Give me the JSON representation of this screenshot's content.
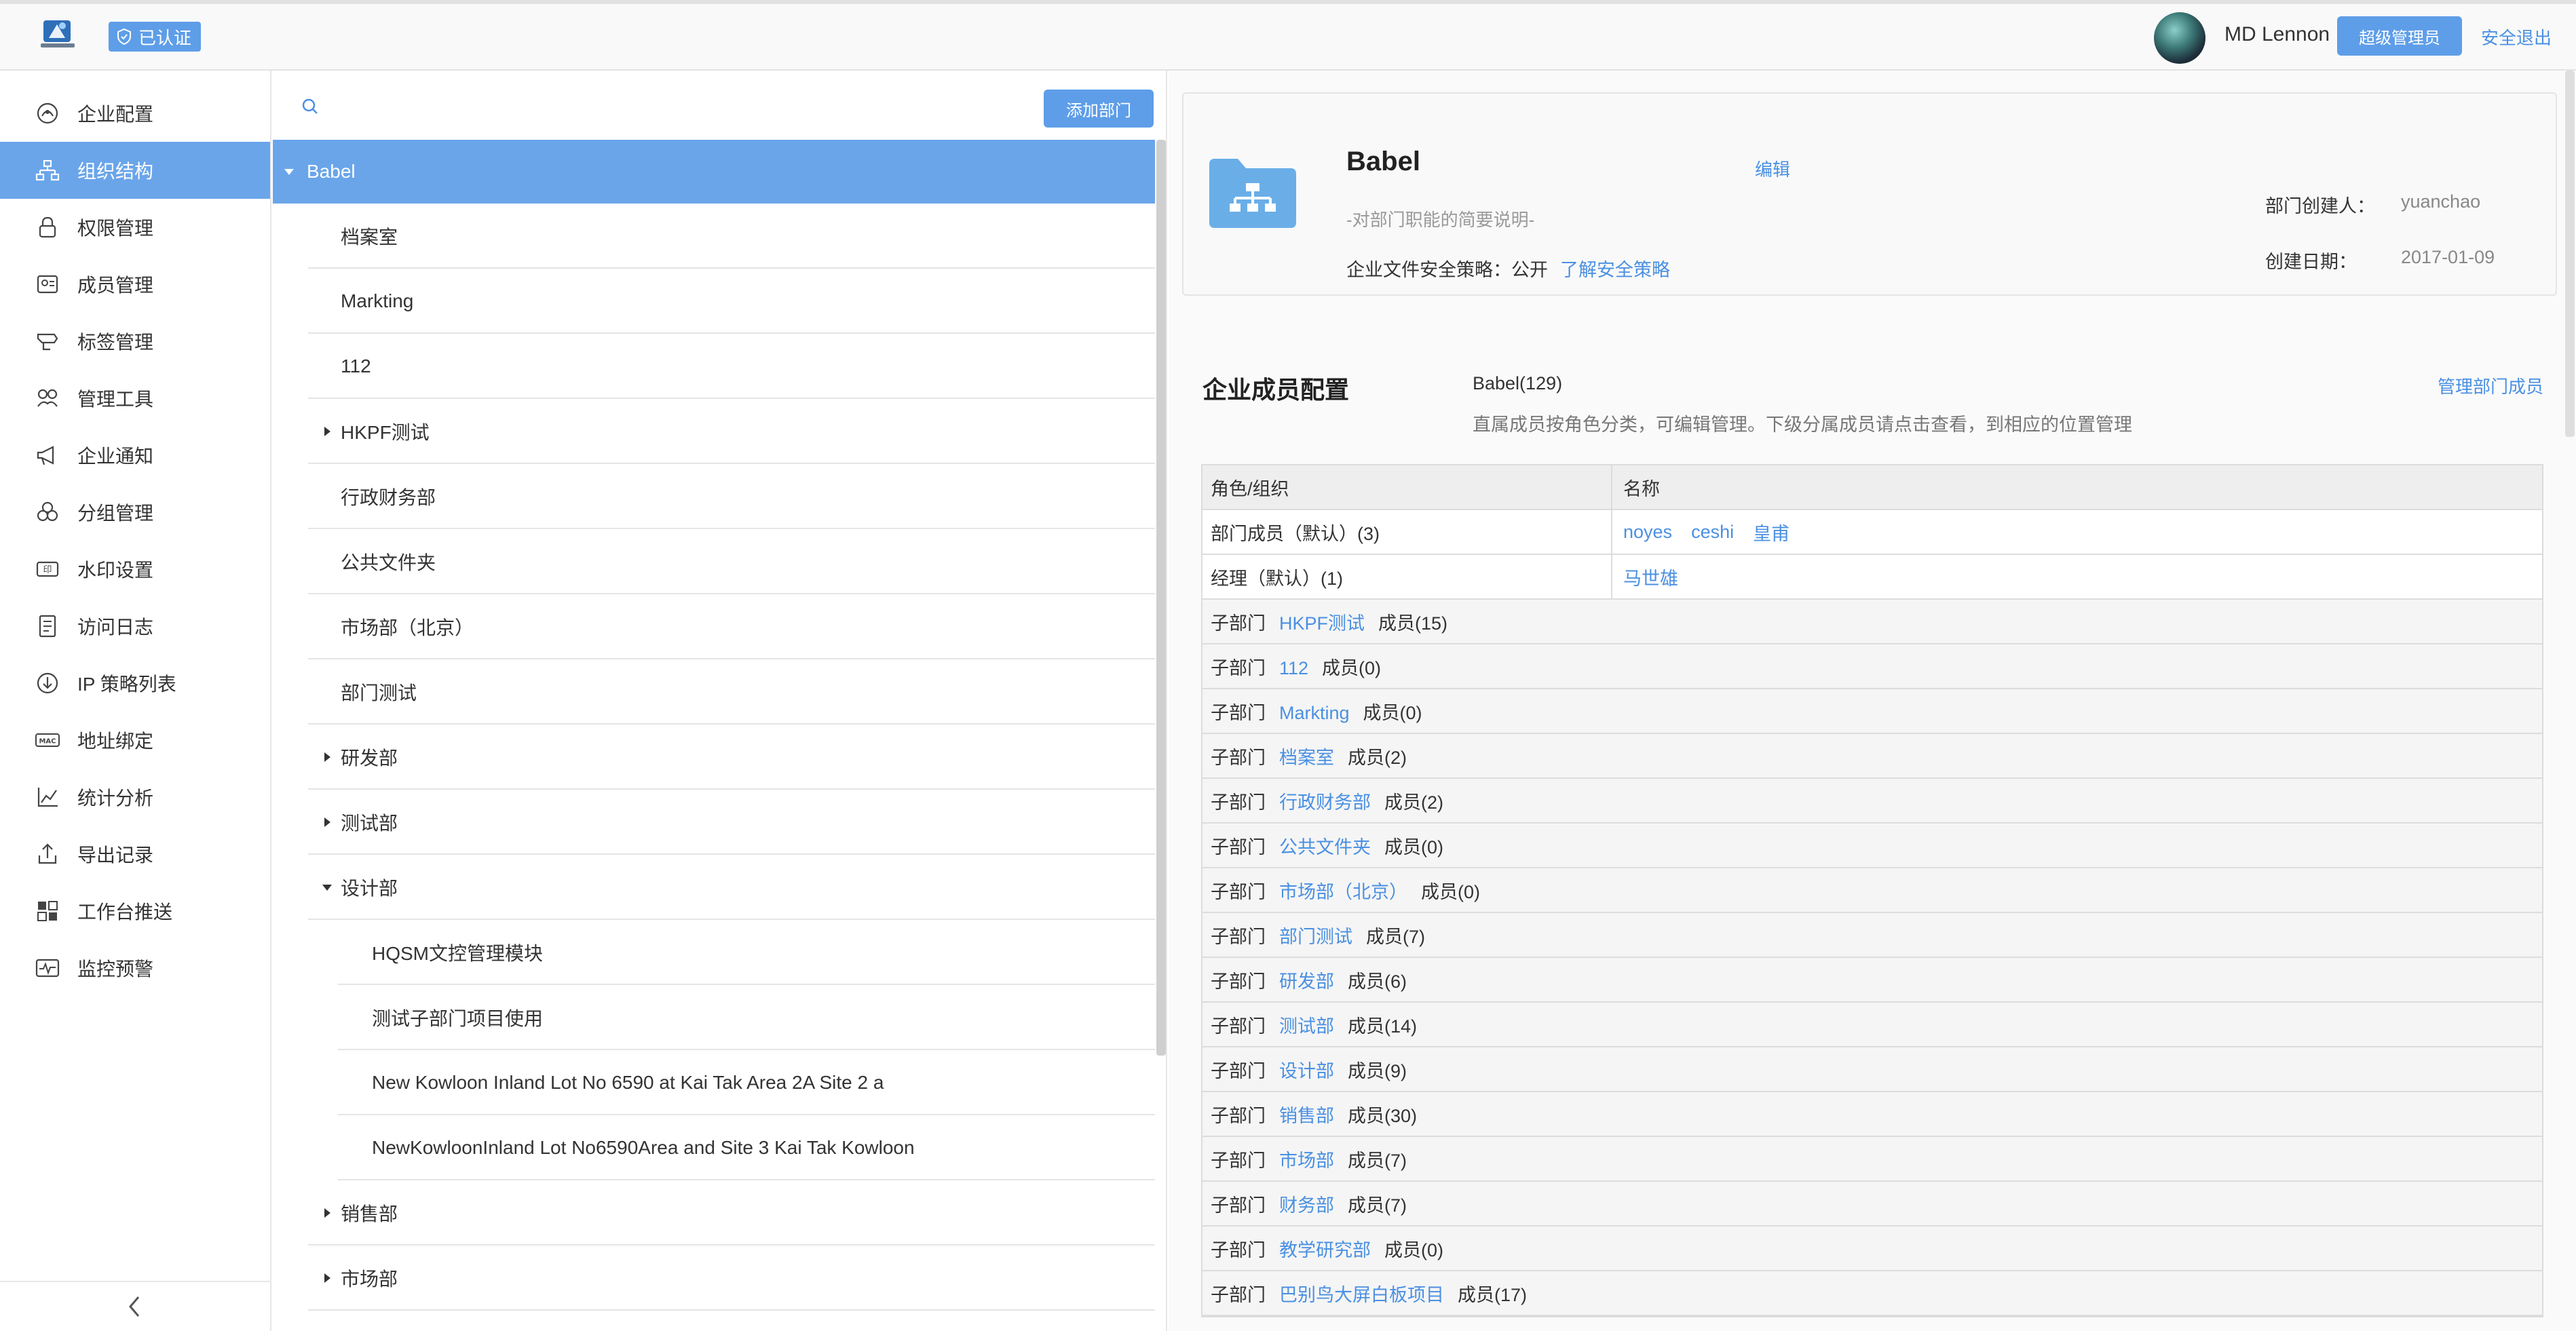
{
  "header": {
    "verified_label": "已认证",
    "username": "MD Lennon",
    "role_label": "超级管理员",
    "logout_label": "安全退出",
    "accent": "#5e9ee8"
  },
  "sidebar": {
    "items": [
      {
        "label": "企业配置",
        "icon": "enterprise-config-icon"
      },
      {
        "label": "组织结构",
        "icon": "org-structure-icon",
        "active": true
      },
      {
        "label": "权限管理",
        "icon": "lock-icon"
      },
      {
        "label": "成员管理",
        "icon": "member-card-icon"
      },
      {
        "label": "标签管理",
        "icon": "tag-icon"
      },
      {
        "label": "管理工具",
        "icon": "tools-icon"
      },
      {
        "label": "企业通知",
        "icon": "megaphone-icon"
      },
      {
        "label": "分组管理",
        "icon": "group-icon"
      },
      {
        "label": "水印设置",
        "icon": "watermark-icon"
      },
      {
        "label": "访问日志",
        "icon": "log-icon"
      },
      {
        "label": "IP 策略列表",
        "icon": "ip-policy-icon"
      },
      {
        "label": "地址绑定",
        "icon": "mac-icon"
      },
      {
        "label": "统计分析",
        "icon": "chart-icon"
      },
      {
        "label": "导出记录",
        "icon": "export-icon"
      },
      {
        "label": "工作台推送",
        "icon": "workbench-icon"
      },
      {
        "label": "监控预警",
        "icon": "monitor-icon"
      }
    ],
    "mac_text": "MAC"
  },
  "tree": {
    "add_button": "添加部门",
    "rows": [
      {
        "label": "Babel",
        "level": 0,
        "caret": "down",
        "selected": true
      },
      {
        "label": "档案室",
        "level": 1,
        "caret": ""
      },
      {
        "label": "Markting",
        "level": 1,
        "caret": ""
      },
      {
        "label": "112",
        "level": 1,
        "caret": ""
      },
      {
        "label": "HKPF测试",
        "level": 1,
        "caret": "right"
      },
      {
        "label": "行政财务部",
        "level": 1,
        "caret": ""
      },
      {
        "label": "公共文件夹",
        "level": 1,
        "caret": ""
      },
      {
        "label": "市场部（北京）",
        "level": 1,
        "caret": ""
      },
      {
        "label": "部门测试",
        "level": 1,
        "caret": ""
      },
      {
        "label": "研发部",
        "level": 1,
        "caret": "right"
      },
      {
        "label": "测试部",
        "level": 1,
        "caret": "right"
      },
      {
        "label": "设计部",
        "level": 1,
        "caret": "down"
      },
      {
        "label": "HQSM文控管理模块",
        "level": 2,
        "caret": ""
      },
      {
        "label": "测试子部门项目使用",
        "level": 2,
        "caret": ""
      },
      {
        "label": "New Kowloon Inland Lot No 6590 at Kai Tak Area 2A Site 2 a",
        "level": 2,
        "caret": ""
      },
      {
        "label": "NewKowloonInland Lot No6590Area and Site 3 Kai Tak Kowloon",
        "level": 2,
        "caret": ""
      },
      {
        "label": "销售部",
        "level": 1,
        "caret": "right"
      },
      {
        "label": "市场部",
        "level": 1,
        "caret": "right"
      }
    ]
  },
  "detail": {
    "name": "Babel",
    "edit_label": "编辑",
    "description": "-对部门职能的简要说明-",
    "policy_label": "企业文件安全策略：公开",
    "policy_link": "了解安全策略",
    "creator_key": "部门创建人：",
    "creator_value": "yuanchao",
    "date_key": "创建日期：",
    "date_value": "2017-01-09"
  },
  "members": {
    "title": "企业成员配置",
    "subtitle": "Babel(129)",
    "note": "直属成员按角色分类，可编辑管理。下级分属成员请点击查看，到相应的位置管理",
    "manage_link": "管理部门成员",
    "col_role": "角色/组织",
    "col_name": "名称",
    "role_rows": [
      {
        "role": "部门成员（默认）(3)",
        "names": [
          "noyes",
          "ceshi",
          "皇甫"
        ]
      },
      {
        "role": "经理（默认）(1)",
        "names": [
          "马世雄"
        ]
      }
    ],
    "sub_prefix": "子部门",
    "sub_rows": [
      {
        "dept": "HKPF测试",
        "count": "成员(15)"
      },
      {
        "dept": "112",
        "count": "成员(0)"
      },
      {
        "dept": "Markting",
        "count": "成员(0)"
      },
      {
        "dept": "档案室",
        "count": "成员(2)"
      },
      {
        "dept": "行政财务部",
        "count": "成员(2)"
      },
      {
        "dept": "公共文件夹",
        "count": "成员(0)"
      },
      {
        "dept": "市场部（北京）",
        "count": "成员(0)"
      },
      {
        "dept": "部门测试",
        "count": "成员(7)"
      },
      {
        "dept": "研发部",
        "count": "成员(6)"
      },
      {
        "dept": "测试部",
        "count": "成员(14)"
      },
      {
        "dept": "设计部",
        "count": "成员(9)"
      },
      {
        "dept": "销售部",
        "count": "成员(30)"
      },
      {
        "dept": "市场部",
        "count": "成员(7)"
      },
      {
        "dept": "财务部",
        "count": "成员(7)"
      },
      {
        "dept": "教学研究部",
        "count": "成员(0)"
      },
      {
        "dept": "巴别鸟大屏白板项目",
        "count": "成员(17)"
      }
    ]
  }
}
